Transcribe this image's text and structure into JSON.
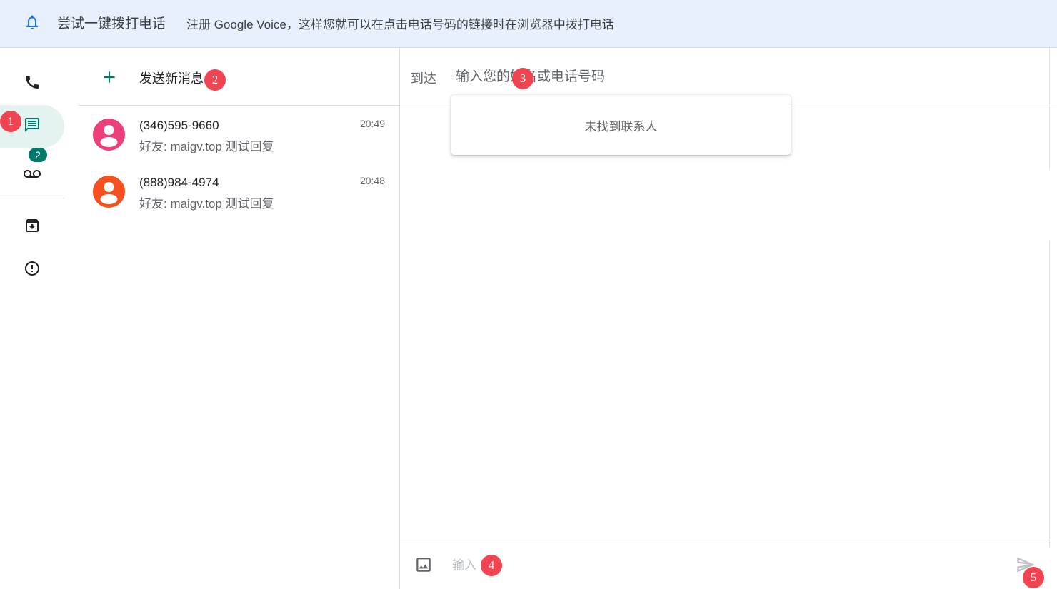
{
  "banner": {
    "title": "尝试一键拨打电话",
    "description": "注册 Google Voice，这样您就可以在点击电话号码的链接时在浏览器中拨打电话",
    "icon": "bell-icon"
  },
  "rail": {
    "items": [
      {
        "name": "calls",
        "icon": "phone-icon"
      },
      {
        "name": "messages",
        "icon": "message-icon",
        "active": true
      },
      {
        "name": "voicemail",
        "icon": "voicemail-icon",
        "badge": "2"
      },
      {
        "name": "archive",
        "icon": "archive-icon"
      },
      {
        "name": "spam",
        "icon": "spam-icon"
      }
    ],
    "voicemail_badge": "2"
  },
  "list": {
    "new_message_label": "发送新消息",
    "conversations": [
      {
        "phone": "(346)595-9660",
        "snippet": "好友: maigv.top 测试回复",
        "time": "20:49",
        "avatar_color": "#ec407a"
      },
      {
        "phone": "(888)984-4974",
        "snippet": "好友: maigv.top 测试回复",
        "time": "20:48",
        "avatar_color": "#f4511e"
      }
    ]
  },
  "thread": {
    "to_label": "到达",
    "to_placeholder": "输入您的姓名或电话号码",
    "no_contacts_text": "未找到联系人",
    "message_placeholder": "输入"
  },
  "markers": [
    "1",
    "2",
    "3",
    "4",
    "5"
  ],
  "colors": {
    "accent": "#00796b",
    "banner_bg": "#e8f0fe",
    "active_bg": "#e4f3f0",
    "marker": "#f04453"
  }
}
